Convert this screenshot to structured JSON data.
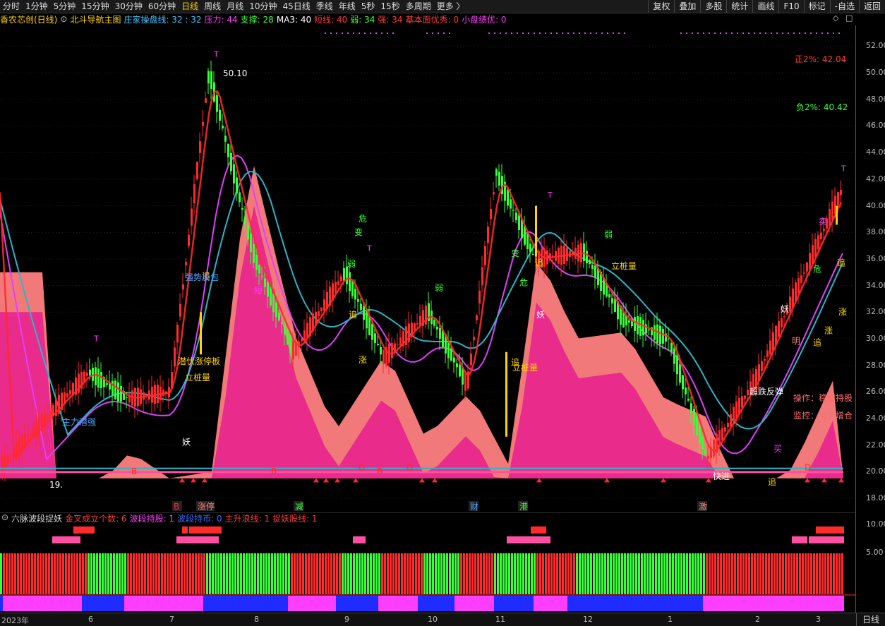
{
  "toolbar": {
    "periods": [
      "分时",
      "1分钟",
      "5分钟",
      "15分钟",
      "30分钟",
      "60分钟",
      "日线",
      "周线",
      "月线",
      "10分钟",
      "45日线",
      "季线",
      "年线",
      "5秒",
      "15秒",
      "多周期",
      "更多 〉"
    ],
    "active_period": "日线",
    "right_buttons": [
      "复权",
      "叠加",
      "多股",
      "统计",
      "画线",
      "F10",
      "标记",
      "-自选",
      "返回"
    ]
  },
  "infobar": {
    "stock_title": "香农芯创(日线)",
    "indicator_name": "北斗导航主图",
    "items": [
      {
        "text": "庄家操盘线: 32 : 32",
        "color": "#46c3ff"
      },
      {
        "text": "压力: 44",
        "color": "#ff3dff"
      },
      {
        "text": "支撑: 28",
        "color": "#39ff39"
      },
      {
        "text": "MA3: 40",
        "color": "#ffffff"
      },
      {
        "text": "短线: 40",
        "color": "#ff3b3b"
      },
      {
        "text": "弱: 34",
        "color": "#39ff39"
      },
      {
        "text": "强: 34",
        "color": "#ff3b3b"
      },
      {
        "text": "基本面优秀: 0",
        "color": "#ff3b3b"
      },
      {
        "text": "小盘绩优: 0",
        "color": "#ff3dff"
      }
    ]
  },
  "main_labels": {
    "zheng": "正2%: 42.04",
    "fu": "负2%: 40.42",
    "high_price": "50.10",
    "low_price": "19.",
    "op_line": "操作：稳健持股",
    "monitor_line": "监控：主力增仓",
    "zhuli_qianqiang": "主力潜强",
    "qiangshi_fanbao": "强势反包",
    "maifu_zhangting": "潜伏涨停板",
    "lizhuliang": "立桩量",
    "dieyi_fantan": "超跌反弹",
    "kuaijin": "快进"
  },
  "y_axis_main": [
    "52.00",
    "50.00",
    "48.00",
    "46.00",
    "44.00",
    "42.00",
    "40.00",
    "38.00",
    "36.00",
    "34.00",
    "32.00",
    "30.00",
    "28.00",
    "26.00",
    "24.00",
    "22.00",
    "20.00",
    "18.00"
  ],
  "y_axis_sub": [
    "10.00",
    "5.00"
  ],
  "x_axis": [
    "2023年",
    "6",
    "7",
    "8",
    "9",
    "10",
    "11",
    "12",
    "1",
    "2",
    "3"
  ],
  "bottom_right": "日线",
  "sub_legend": {
    "title": "六脉波段捉妖",
    "items": [
      {
        "text": "金叉成立个数: 6",
        "color": "#ff3b3b"
      },
      {
        "text": "波段持股: 1",
        "color": "#ff3dff"
      },
      {
        "text": "波段持币: 0",
        "color": "#3b6bff"
      },
      {
        "text": "主升浪线: 1",
        "color": "#ff3b3b"
      },
      {
        "text": "捉妖股线: 1",
        "color": "#ff3b3b"
      }
    ]
  },
  "markers": {
    "T": "T",
    "chase": "追",
    "rise": "涨",
    "demon": "妖",
    "danger": "危",
    "change": "变",
    "weak": "弱",
    "strong": "强",
    "short": "短",
    "B": "B",
    "D": "D",
    "buy": "买",
    "sell": "卖",
    "bright": "明",
    "reduce": "减",
    "wealth": "财",
    "port": "港",
    "boost": "激",
    "limit": "涨停"
  },
  "chart_data": {
    "type": "candlestick",
    "title": "香农芯创(日线)",
    "ylim": [
      18,
      52.5
    ],
    "x_labels": [
      "2023年",
      "6",
      "7",
      "8",
      "9",
      "10",
      "11",
      "12",
      "1",
      "2",
      "3"
    ],
    "approx_close_path": [
      {
        "x": "2023年",
        "y": 20.5
      },
      {
        "x": "6",
        "y": 27.5
      },
      {
        "x": "6",
        "y": 25.5
      },
      {
        "x": "7",
        "y": 26.0
      },
      {
        "x": "7",
        "y": 50.1
      },
      {
        "x": "7",
        "y": 38.0
      },
      {
        "x": "8",
        "y": 36.0
      },
      {
        "x": "8",
        "y": 29.0
      },
      {
        "x": "9",
        "y": 35.0
      },
      {
        "x": "9",
        "y": 28.5
      },
      {
        "x": "10",
        "y": 32.0
      },
      {
        "x": "10",
        "y": 26.5
      },
      {
        "x": "11",
        "y": 42.5
      },
      {
        "x": "11",
        "y": 36.0
      },
      {
        "x": "12",
        "y": 36.5
      },
      {
        "x": "12",
        "y": 31.5
      },
      {
        "x": "1",
        "y": 30.0
      },
      {
        "x": "1",
        "y": 21.0
      },
      {
        "x": "2",
        "y": 27.0
      },
      {
        "x": "3",
        "y": 41.0
      }
    ],
    "sub_indicator": {
      "name": "六脉波段捉妖",
      "levels": [
        0,
        5,
        10
      ]
    }
  }
}
